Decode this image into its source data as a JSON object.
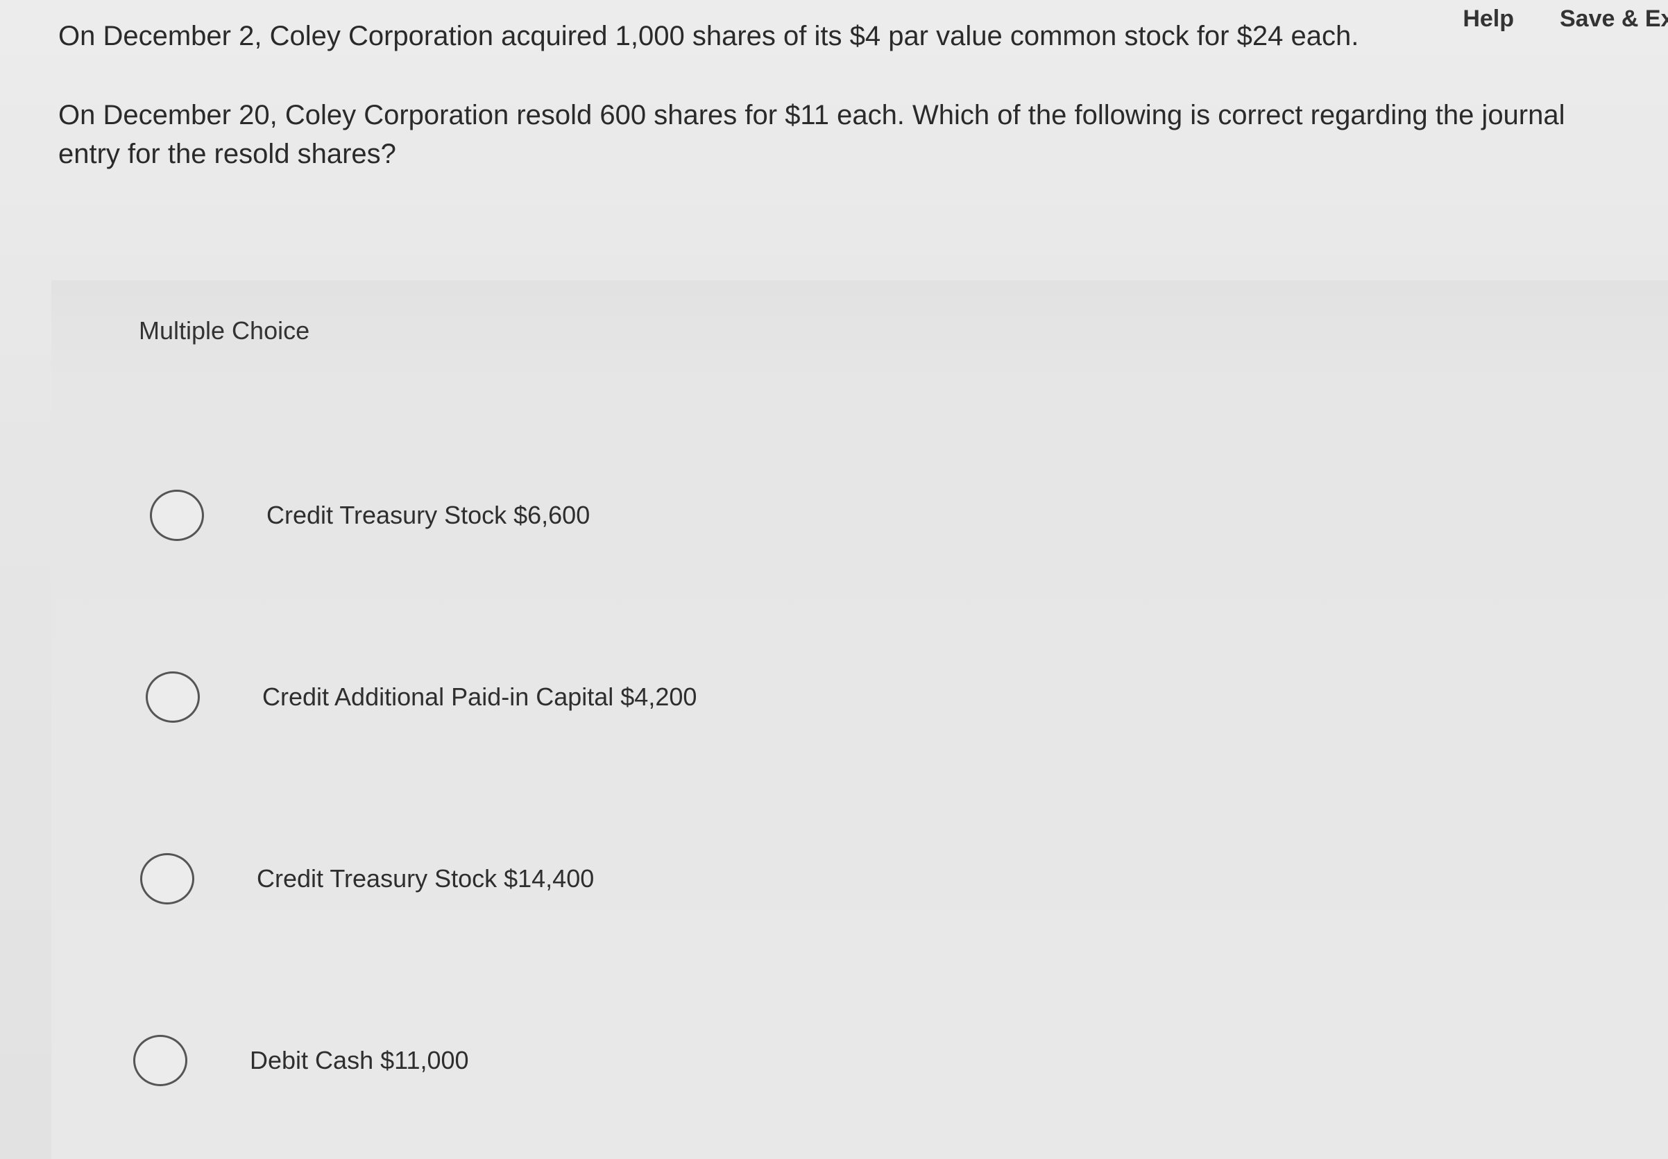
{
  "header": {
    "help_label": "Help",
    "save_exit_label": "Save & Exit"
  },
  "question": {
    "line1": "On December 2, Coley Corporation acquired 1,000 shares of its $4 par value common stock for $24 each.",
    "line2": "On December 20, Coley Corporation resold 600 shares for $11 each. Which of the following is correct regarding the journal entry for the resold shares?"
  },
  "multiple_choice": {
    "header": "Multiple Choice",
    "options": [
      {
        "label": "Credit Treasury Stock $6,600"
      },
      {
        "label": "Credit Additional Paid-in Capital $4,200"
      },
      {
        "label": "Credit Treasury Stock $14,400"
      },
      {
        "label": "Debit Cash $11,000"
      }
    ]
  }
}
